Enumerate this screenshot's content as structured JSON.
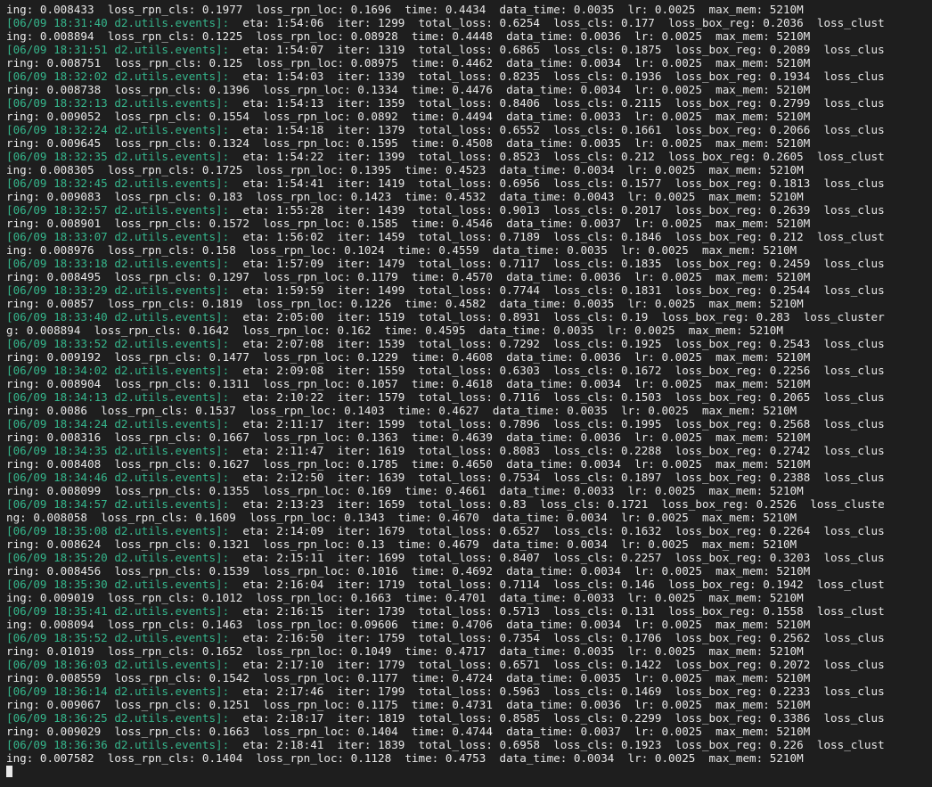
{
  "theme": {
    "background": "#1e1e1e",
    "foreground": "#e8e8e8",
    "prefix_color": "#35b58b"
  },
  "lines": [
    {
      "prefix": "",
      "text": "ing: 0.008433  loss_rpn_cls: 0.1977  loss_rpn_loc: 0.1696  time: 0.4434  data_time: 0.0035  lr: 0.0025  max_mem: 5210M"
    },
    {
      "prefix": "[06/09 18:31:40 d2.utils.events]:",
      "text": "  eta: 1:54:06  iter: 1299  total_loss: 0.6254  loss_cls: 0.177  loss_box_reg: 0.2036  loss_clust"
    },
    {
      "prefix": "",
      "text": "ing: 0.008894  loss_rpn_cls: 0.1225  loss_rpn_loc: 0.08928  time: 0.4448  data_time: 0.0036  lr: 0.0025  max_mem: 5210M"
    },
    {
      "prefix": "[06/09 18:31:51 d2.utils.events]:",
      "text": "  eta: 1:54:07  iter: 1319  total_loss: 0.6865  loss_cls: 0.1875  loss_box_reg: 0.2089  loss_clus"
    },
    {
      "prefix": "",
      "text": "ring: 0.008751  loss_rpn_cls: 0.125  loss_rpn_loc: 0.08975  time: 0.4462  data_time: 0.0034  lr: 0.0025  max_mem: 5210M"
    },
    {
      "prefix": "[06/09 18:32:02 d2.utils.events]:",
      "text": "  eta: 1:54:03  iter: 1339  total_loss: 0.8235  loss_cls: 0.1936  loss_box_reg: 0.1934  loss_clus"
    },
    {
      "prefix": "",
      "text": "ring: 0.008738  loss_rpn_cls: 0.1396  loss_rpn_loc: 0.1334  time: 0.4476  data_time: 0.0034  lr: 0.0025  max_mem: 5210M"
    },
    {
      "prefix": "[06/09 18:32:13 d2.utils.events]:",
      "text": "  eta: 1:54:13  iter: 1359  total_loss: 0.8406  loss_cls: 0.2115  loss_box_reg: 0.2799  loss_clus"
    },
    {
      "prefix": "",
      "text": "ring: 0.009052  loss_rpn_cls: 0.1554  loss_rpn_loc: 0.0892  time: 0.4494  data_time: 0.0033  lr: 0.0025  max_mem: 5210M"
    },
    {
      "prefix": "[06/09 18:32:24 d2.utils.events]:",
      "text": "  eta: 1:54:18  iter: 1379  total_loss: 0.6552  loss_cls: 0.1661  loss_box_reg: 0.2066  loss_clus"
    },
    {
      "prefix": "",
      "text": "ring: 0.009645  loss_rpn_cls: 0.1324  loss_rpn_loc: 0.1595  time: 0.4508  data_time: 0.0035  lr: 0.0025  max_mem: 5210M"
    },
    {
      "prefix": "[06/09 18:32:35 d2.utils.events]:",
      "text": "  eta: 1:54:22  iter: 1399  total_loss: 0.8523  loss_cls: 0.212  loss_box_reg: 0.2605  loss_clust"
    },
    {
      "prefix": "",
      "text": "ing: 0.008305  loss_rpn_cls: 0.1725  loss_rpn_loc: 0.1395  time: 0.4523  data_time: 0.0034  lr: 0.0025  max_mem: 5210M"
    },
    {
      "prefix": "[06/09 18:32:45 d2.utils.events]:",
      "text": "  eta: 1:54:41  iter: 1419  total_loss: 0.6956  loss_cls: 0.1577  loss_box_reg: 0.1813  loss_clus"
    },
    {
      "prefix": "",
      "text": "ring: 0.009083  loss_rpn_cls: 0.183  loss_rpn_loc: 0.1423  time: 0.4532  data_time: 0.0043  lr: 0.0025  max_mem: 5210M"
    },
    {
      "prefix": "[06/09 18:32:57 d2.utils.events]:",
      "text": "  eta: 1:55:28  iter: 1439  total_loss: 0.9013  loss_cls: 0.2017  loss_box_reg: 0.2639  loss_clus"
    },
    {
      "prefix": "",
      "text": "ring: 0.008901  loss_rpn_cls: 0.1572  loss_rpn_loc: 0.1585  time: 0.4546  data_time: 0.0037  lr: 0.0025  max_mem: 5210M"
    },
    {
      "prefix": "[06/09 18:33:07 d2.utils.events]:",
      "text": "  eta: 1:56:02  iter: 1459  total_loss: 0.7189  loss_cls: 0.1846  loss_box_reg: 0.212  loss_clust"
    },
    {
      "prefix": "",
      "text": "ing: 0.008976  loss_rpn_cls: 0.158  loss_rpn_loc: 0.1024  time: 0.4559  data_time: 0.0035  lr: 0.0025  max_mem: 5210M"
    },
    {
      "prefix": "[06/09 18:33:18 d2.utils.events]:",
      "text": "  eta: 1:57:09  iter: 1479  total_loss: 0.7117  loss_cls: 0.1835  loss_box_reg: 0.2459  loss_clus"
    },
    {
      "prefix": "",
      "text": "ring: 0.008495  loss_rpn_cls: 0.1297  loss_rpn_loc: 0.1179  time: 0.4570  data_time: 0.0036  lr: 0.0025  max_mem: 5210M"
    },
    {
      "prefix": "[06/09 18:33:29 d2.utils.events]:",
      "text": "  eta: 1:59:59  iter: 1499  total_loss: 0.7744  loss_cls: 0.1831  loss_box_reg: 0.2544  loss_clus"
    },
    {
      "prefix": "",
      "text": "ring: 0.00857  loss_rpn_cls: 0.1819  loss_rpn_loc: 0.1226  time: 0.4582  data_time: 0.0035  lr: 0.0025  max_mem: 5210M"
    },
    {
      "prefix": "[06/09 18:33:40 d2.utils.events]:",
      "text": "  eta: 2:05:00  iter: 1519  total_loss: 0.8931  loss_cls: 0.19  loss_box_reg: 0.283  loss_cluster"
    },
    {
      "prefix": "",
      "text": "g: 0.008894  loss_rpn_cls: 0.1642  loss_rpn_loc: 0.162  time: 0.4595  data_time: 0.0035  lr: 0.0025  max_mem: 5210M"
    },
    {
      "prefix": "[06/09 18:33:52 d2.utils.events]:",
      "text": "  eta: 2:07:08  iter: 1539  total_loss: 0.7292  loss_cls: 0.1925  loss_box_reg: 0.2543  loss_clus"
    },
    {
      "prefix": "",
      "text": "ring: 0.009192  loss_rpn_cls: 0.1477  loss_rpn_loc: 0.1229  time: 0.4608  data_time: 0.0036  lr: 0.0025  max_mem: 5210M"
    },
    {
      "prefix": "[06/09 18:34:02 d2.utils.events]:",
      "text": "  eta: 2:09:08  iter: 1559  total_loss: 0.6303  loss_cls: 0.1672  loss_box_reg: 0.2256  loss_clus"
    },
    {
      "prefix": "",
      "text": "ring: 0.008904  loss_rpn_cls: 0.1311  loss_rpn_loc: 0.1057  time: 0.4618  data_time: 0.0034  lr: 0.0025  max_mem: 5210M"
    },
    {
      "prefix": "[06/09 18:34:13 d2.utils.events]:",
      "text": "  eta: 2:10:22  iter: 1579  total_loss: 0.7116  loss_cls: 0.1503  loss_box_reg: 0.2065  loss_clus"
    },
    {
      "prefix": "",
      "text": "ring: 0.0086  loss_rpn_cls: 0.1537  loss_rpn_loc: 0.1403  time: 0.4627  data_time: 0.0035  lr: 0.0025  max_mem: 5210M"
    },
    {
      "prefix": "[06/09 18:34:24 d2.utils.events]:",
      "text": "  eta: 2:11:17  iter: 1599  total_loss: 0.7896  loss_cls: 0.1995  loss_box_reg: 0.2568  loss_clus"
    },
    {
      "prefix": "",
      "text": "ring: 0.008316  loss_rpn_cls: 0.1667  loss_rpn_loc: 0.1363  time: 0.4639  data_time: 0.0036  lr: 0.0025  max_mem: 5210M"
    },
    {
      "prefix": "[06/09 18:34:35 d2.utils.events]:",
      "text": "  eta: 2:11:47  iter: 1619  total_loss: 0.8083  loss_cls: 0.2288  loss_box_reg: 0.2742  loss_clus"
    },
    {
      "prefix": "",
      "text": "ring: 0.008408  loss_rpn_cls: 0.1627  loss_rpn_loc: 0.1785  time: 0.4650  data_time: 0.0034  lr: 0.0025  max_mem: 5210M"
    },
    {
      "prefix": "[06/09 18:34:46 d2.utils.events]:",
      "text": "  eta: 2:12:50  iter: 1639  total_loss: 0.7534  loss_cls: 0.1897  loss_box_reg: 0.2388  loss_clus"
    },
    {
      "prefix": "",
      "text": "ring: 0.008099  loss_rpn_cls: 0.1355  loss_rpn_loc: 0.169  time: 0.4661  data_time: 0.0033  lr: 0.0025  max_mem: 5210M"
    },
    {
      "prefix": "[06/09 18:34:57 d2.utils.events]:",
      "text": "  eta: 2:13:23  iter: 1659  total_loss: 0.83  loss_cls: 0.1721  loss_box_reg: 0.2526  loss_cluste"
    },
    {
      "prefix": "",
      "text": "ng: 0.008058  loss_rpn_cls: 0.1609  loss_rpn_loc: 0.1343  time: 0.4670  data_time: 0.0034  lr: 0.0025  max_mem: 5210M"
    },
    {
      "prefix": "[06/09 18:35:08 d2.utils.events]:",
      "text": "  eta: 2:14:09  iter: 1679  total_loss: 0.6527  loss_cls: 0.1632  loss_box_reg: 0.2264  loss_clus"
    },
    {
      "prefix": "",
      "text": "ring: 0.008624  loss_rpn_cls: 0.1321  loss_rpn_loc: 0.13  time: 0.4679  data_time: 0.0034  lr: 0.0025  max_mem: 5210M"
    },
    {
      "prefix": "[06/09 18:35:20 d2.utils.events]:",
      "text": "  eta: 2:15:11  iter: 1699  total_loss: 0.8407  loss_cls: 0.2257  loss_box_reg: 0.3203  loss_clus"
    },
    {
      "prefix": "",
      "text": "ring: 0.008456  loss_rpn_cls: 0.1539  loss_rpn_loc: 0.1016  time: 0.4692  data_time: 0.0034  lr: 0.0025  max_mem: 5210M"
    },
    {
      "prefix": "[06/09 18:35:30 d2.utils.events]:",
      "text": "  eta: 2:16:04  iter: 1719  total_loss: 0.7114  loss_cls: 0.146  loss_box_reg: 0.1942  loss_clust"
    },
    {
      "prefix": "",
      "text": "ing: 0.009019  loss_rpn_cls: 0.1012  loss_rpn_loc: 0.1663  time: 0.4701  data_time: 0.0033  lr: 0.0025  max_mem: 5210M"
    },
    {
      "prefix": "[06/09 18:35:41 d2.utils.events]:",
      "text": "  eta: 2:16:15  iter: 1739  total_loss: 0.5713  loss_cls: 0.131  loss_box_reg: 0.1558  loss_clust"
    },
    {
      "prefix": "",
      "text": "ing: 0.008094  loss_rpn_cls: 0.1463  loss_rpn_loc: 0.09606  time: 0.4706  data_time: 0.0034  lr: 0.0025  max_mem: 5210M"
    },
    {
      "prefix": "[06/09 18:35:52 d2.utils.events]:",
      "text": "  eta: 2:16:50  iter: 1759  total_loss: 0.7354  loss_cls: 0.1706  loss_box_reg: 0.2562  loss_clus"
    },
    {
      "prefix": "",
      "text": "ring: 0.01019  loss_rpn_cls: 0.1652  loss_rpn_loc: 0.1049  time: 0.4717  data_time: 0.0035  lr: 0.0025  max_mem: 5210M"
    },
    {
      "prefix": "[06/09 18:36:03 d2.utils.events]:",
      "text": "  eta: 2:17:10  iter: 1779  total_loss: 0.6571  loss_cls: 0.1422  loss_box_reg: 0.2072  loss_clus"
    },
    {
      "prefix": "",
      "text": "ring: 0.008559  loss_rpn_cls: 0.1542  loss_rpn_loc: 0.1177  time: 0.4724  data_time: 0.0035  lr: 0.0025  max_mem: 5210M"
    },
    {
      "prefix": "[06/09 18:36:14 d2.utils.events]:",
      "text": "  eta: 2:17:46  iter: 1799  total_loss: 0.5963  loss_cls: 0.1469  loss_box_reg: 0.2233  loss_clus"
    },
    {
      "prefix": "",
      "text": "ring: 0.009067  loss_rpn_cls: 0.1251  loss_rpn_loc: 0.1175  time: 0.4731  data_time: 0.0036  lr: 0.0025  max_mem: 5210M"
    },
    {
      "prefix": "[06/09 18:36:25 d2.utils.events]:",
      "text": "  eta: 2:18:17  iter: 1819  total_loss: 0.8585  loss_cls: 0.2299  loss_box_reg: 0.3386  loss_clus"
    },
    {
      "prefix": "",
      "text": "ring: 0.009029  loss_rpn_cls: 0.1663  loss_rpn_loc: 0.1404  time: 0.4744  data_time: 0.0037  lr: 0.0025  max_mem: 5210M"
    },
    {
      "prefix": "[06/09 18:36:36 d2.utils.events]:",
      "text": "  eta: 2:18:41  iter: 1839  total_loss: 0.6958  loss_cls: 0.1923  loss_box_reg: 0.226  loss_clust"
    },
    {
      "prefix": "",
      "text": "ing: 0.007582  loss_rpn_cls: 0.1404  loss_rpn_loc: 0.1128  time: 0.4753  data_time: 0.0034  lr: 0.0025  max_mem: 5210M"
    }
  ]
}
